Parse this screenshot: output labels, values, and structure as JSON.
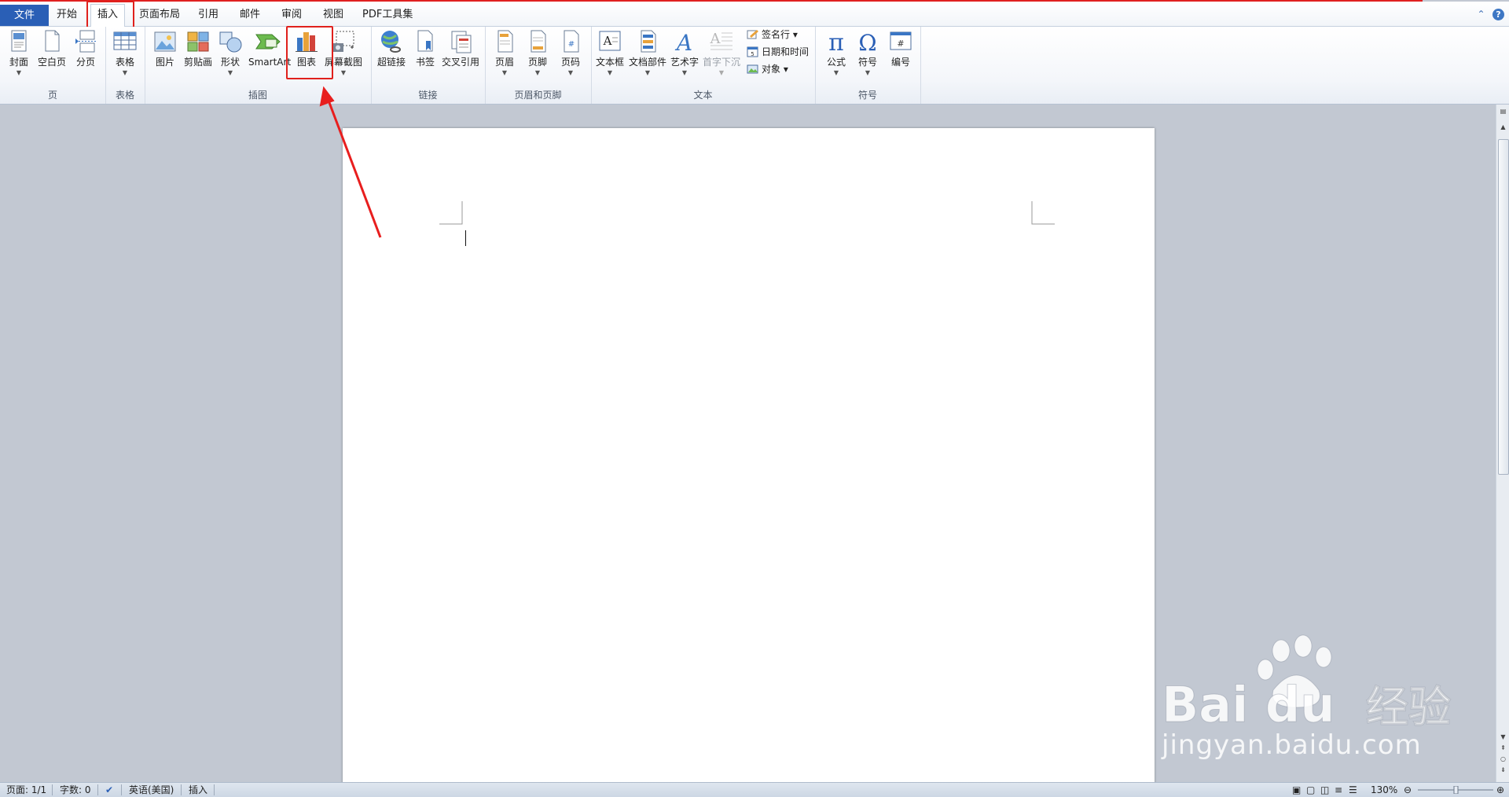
{
  "tabs": {
    "file": "文件",
    "home": "开始",
    "insert": "插入",
    "layout": "页面布局",
    "references": "引用",
    "mailings": "邮件",
    "review": "审阅",
    "view": "视图",
    "pdf": "PDF工具集"
  },
  "ribbon": {
    "pages": {
      "label": "页",
      "cover": "封面",
      "blank": "空白页",
      "break": "分页"
    },
    "tables": {
      "label": "表格",
      "table": "表格"
    },
    "illustrations": {
      "label": "插图",
      "picture": "图片",
      "clipart": "剪贴画",
      "shapes": "形状",
      "smartart": "SmartArt",
      "chart": "图表",
      "screenshot": "屏幕截图"
    },
    "links": {
      "label": "链接",
      "hyperlink": "超链接",
      "bookmark": "书签",
      "crossref": "交叉引用"
    },
    "headerfooter": {
      "label": "页眉和页脚",
      "header": "页眉",
      "footer": "页脚",
      "pagenum": "页码"
    },
    "text": {
      "label": "文本",
      "textbox": "文本框",
      "quickparts": "文档部件",
      "wordart": "艺术字",
      "dropcap": "首字下沉",
      "signature": "签名行",
      "datetime": "日期和时间",
      "object": "对象"
    },
    "symbols": {
      "label": "符号",
      "equation": "公式",
      "symbol": "符号",
      "number": "编号"
    }
  },
  "icons": {
    "equation_glyph": "π",
    "symbol_glyph": "Ω",
    "number_glyph": "#",
    "textbox_glyph": "A",
    "wordart_glyph": "A",
    "dropcap_glyph": "A"
  },
  "statusbar": {
    "page": "页面: 1/1",
    "words": "字数: 0",
    "language": "英语(美国)",
    "mode": "插入",
    "zoom": "130%"
  },
  "watermark": {
    "brand": "Bai du",
    "brand_cn": "经验",
    "url": "jingyan.baidu.com"
  },
  "colors": {
    "accent": "#2a5fb6",
    "highlight": "#e0201c",
    "ribbon_bg": "#f4f6fa",
    "workspace": "#c2c8d2"
  }
}
